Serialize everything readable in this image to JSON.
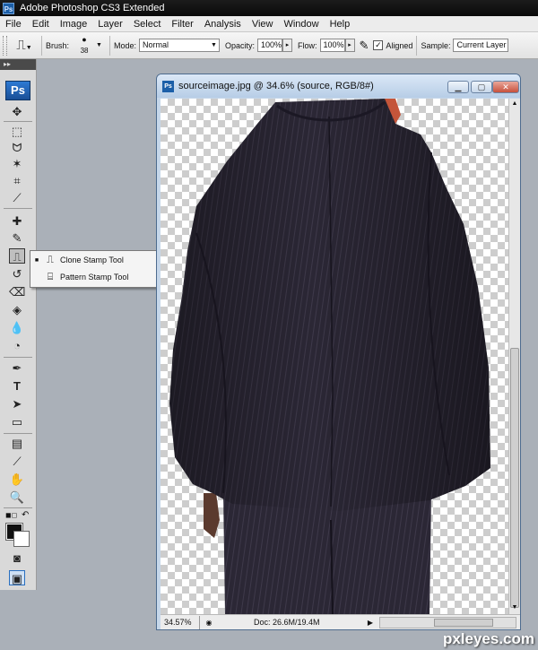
{
  "app": {
    "title": "Adobe Photoshop CS3 Extended",
    "icon": "ps-app-icon"
  },
  "menu": [
    "File",
    "Edit",
    "Image",
    "Layer",
    "Select",
    "Filter",
    "Analysis",
    "View",
    "Window",
    "Help"
  ],
  "options": {
    "brush_label": "Brush:",
    "brush_size": "38",
    "mode_label": "Mode:",
    "mode_value": "Normal",
    "opacity_label": "Opacity:",
    "opacity_value": "100%",
    "flow_label": "Flow:",
    "flow_value": "100%",
    "aligned_label": "Aligned",
    "aligned_checked": true,
    "sample_label": "Sample:",
    "sample_value": "Current Layer"
  },
  "toolbox": {
    "logo": "Ps",
    "active_tool": "clone-stamp-tool"
  },
  "flyout": {
    "items": [
      {
        "label": "Clone Stamp Tool",
        "key": "S",
        "selected": true,
        "icon": "clone-stamp-icon"
      },
      {
        "label": "Pattern Stamp Tool",
        "key": "S",
        "selected": false,
        "icon": "pattern-stamp-icon"
      }
    ]
  },
  "document": {
    "title": "sourceimage.jpg @ 34.6% (source, RGB/8#)",
    "zoom": "34.57%",
    "doc_size": "Doc: 26.6M/19.4M"
  },
  "colors": {
    "foreground": "#111111",
    "background": "#ffffff",
    "suit": "#2a2633"
  },
  "watermark": "pxleyes.com"
}
